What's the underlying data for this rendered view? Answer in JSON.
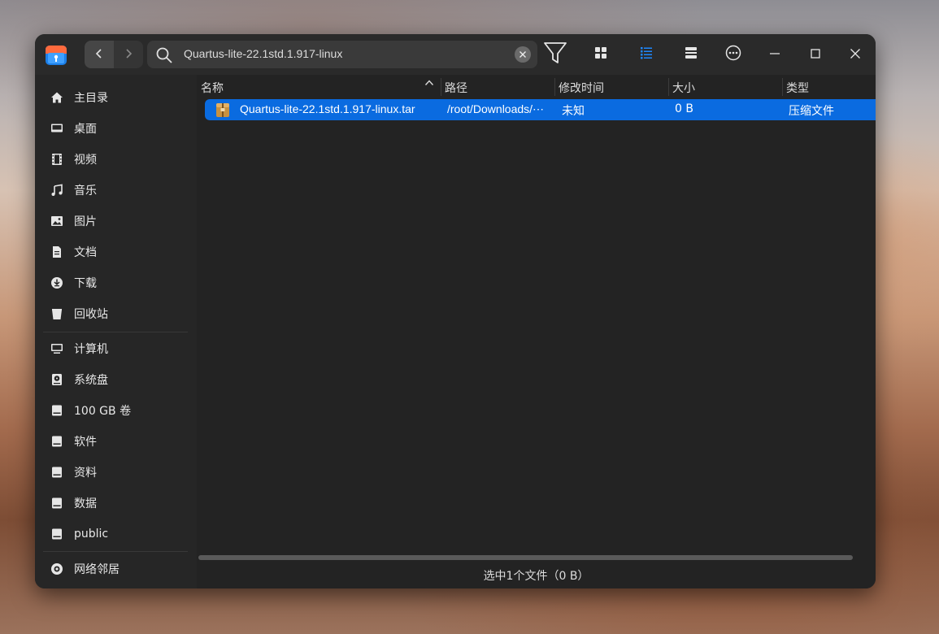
{
  "window": {
    "search": {
      "value": "Quartus-lite-22.1std.1.917-linux"
    },
    "toolbar_icons": [
      "filter-icon",
      "grid-view-icon",
      "list-view-icon",
      "detail-view-icon",
      "more-icon",
      "minimize-icon",
      "maximize-icon",
      "close-icon"
    ]
  },
  "sidebar": {
    "items": [
      {
        "label": "主目录",
        "icon": "home-icon"
      },
      {
        "label": "桌面",
        "icon": "desktop-icon"
      },
      {
        "label": "视频",
        "icon": "video-icon"
      },
      {
        "label": "音乐",
        "icon": "music-icon"
      },
      {
        "label": "图片",
        "icon": "picture-icon"
      },
      {
        "label": "文档",
        "icon": "document-icon"
      },
      {
        "label": "下载",
        "icon": "download-icon"
      },
      {
        "label": "回收站",
        "icon": "trash-icon"
      },
      {
        "label": "计算机",
        "icon": "computer-icon"
      },
      {
        "label": "系统盘",
        "icon": "system-disk-icon"
      },
      {
        "label": "100 GB 卷",
        "icon": "drive-icon"
      },
      {
        "label": "软件",
        "icon": "drive-icon"
      },
      {
        "label": "资料",
        "icon": "drive-icon"
      },
      {
        "label": "数据",
        "icon": "drive-icon"
      },
      {
        "label": "public",
        "icon": "drive-icon"
      },
      {
        "label": "网络邻居",
        "icon": "network-icon"
      }
    ]
  },
  "columns": {
    "name": "名称",
    "path": "路径",
    "modified": "修改时间",
    "size": "大小",
    "type": "类型"
  },
  "files": [
    {
      "name": "Quartus-lite-22.1std.1.917-linux.tar",
      "path": "/root/Downloads/⋯",
      "modified": "未知",
      "size": "0 B",
      "type": "压缩文件"
    }
  ],
  "status": "选中1个文件（0 B）",
  "colors": {
    "accent": "#0a6be0",
    "window_bg": "#252525"
  }
}
